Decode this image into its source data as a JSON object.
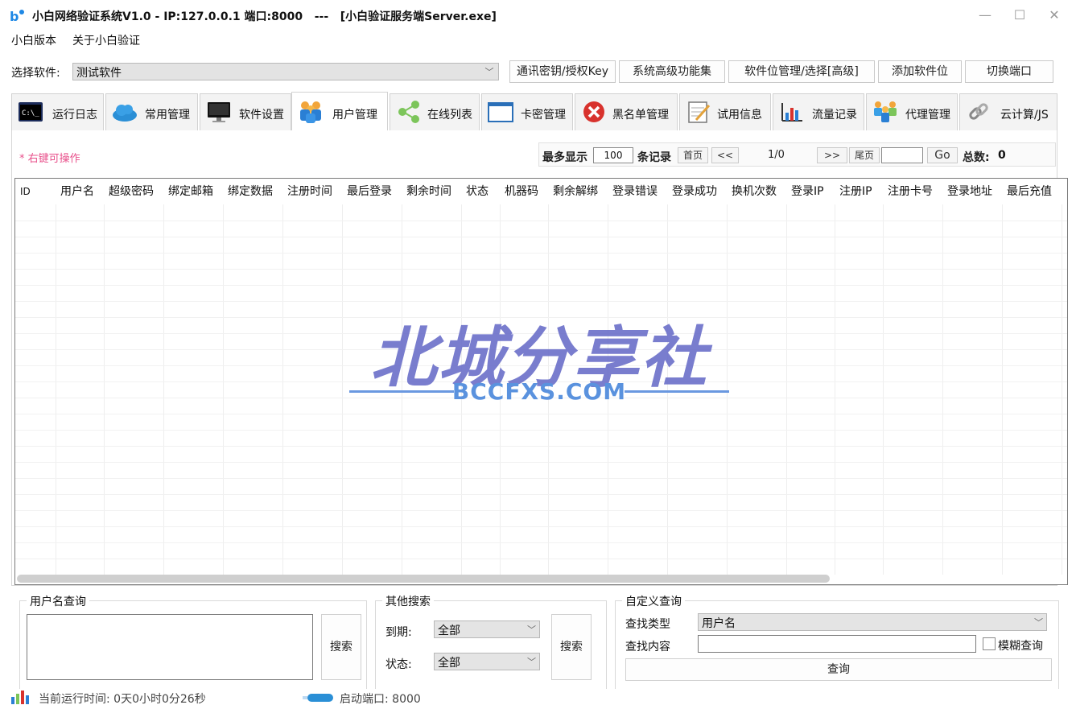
{
  "window": {
    "title": "小白网络验证系统V1.0 - IP:127.0.0.1 端口:8000   ---   [小白验证服务端Server.exe]",
    "minimize": "—",
    "maximize": "☐",
    "close": "✕"
  },
  "menu": [
    "小白版本",
    "关于小白验证"
  ],
  "software_select": {
    "label": "选择软件:",
    "value": "测试软件"
  },
  "top_buttons": [
    "通讯密钥/授权Key",
    "系统高级功能集",
    "软件位管理/选择[高级]",
    "添加软件位",
    "切换端口"
  ],
  "tabs": [
    {
      "label": "运行日志",
      "icon": "console-icon"
    },
    {
      "label": "常用管理",
      "icon": "cloud-icon"
    },
    {
      "label": "软件设置",
      "icon": "monitor-icon"
    },
    {
      "label": "用户管理",
      "icon": "users-icon"
    },
    {
      "label": "在线列表",
      "icon": "share-icon"
    },
    {
      "label": "卡密管理",
      "icon": "window-icon"
    },
    {
      "label": "黑名单管理",
      "icon": "block-icon"
    },
    {
      "label": "试用信息",
      "icon": "notepad-icon"
    },
    {
      "label": "流量记录",
      "icon": "bar-chart-icon"
    },
    {
      "label": "代理管理",
      "icon": "agents-icon"
    },
    {
      "label": "云计算/JS",
      "icon": "chain-link-icon"
    }
  ],
  "hint": "* 右键可操作",
  "pager": {
    "max_label": "最多显示",
    "max_value": "100",
    "records_label": "条记录",
    "first": "首页",
    "prev": "<<",
    "page": "1/0",
    "next": ">>",
    "last": "尾页",
    "goto_value": "",
    "go": "Go",
    "total_label": "总数:",
    "total_value": "0"
  },
  "columns": [
    "ID",
    "用户名",
    "超级密码",
    "绑定邮箱",
    "绑定数据",
    "注册时间",
    "最后登录",
    "剩余时间",
    "状态",
    "机器码",
    "剩余解绑",
    "登录错误",
    "登录成功",
    "换机次数",
    "登录IP",
    "注册IP",
    "注册卡号",
    "登录地址",
    "最后充值"
  ],
  "watermark": {
    "title": "北城分享社",
    "subtitle": "BCCFXS.COM"
  },
  "user_query": {
    "title": "用户名查询",
    "search": "搜索"
  },
  "other_search": {
    "title": "其他搜索",
    "expire_label": "到期:",
    "expire_value": "全部",
    "status_label": "状态:",
    "status_value": "全部",
    "search": "搜索"
  },
  "custom_query": {
    "title": "自定义查询",
    "type_label": "查找类型",
    "type_value": "用户名",
    "content_label": "查找内容",
    "content_value": "",
    "fuzzy_label": "模糊查询",
    "fuzzy_checked": false,
    "query": "查询"
  },
  "status": {
    "runtime": "当前运行时间: 0天0小时0分26秒",
    "port": "启动端口: 8000"
  },
  "colors": {
    "accent": "#1e88e5",
    "hint": "#e8508b",
    "watermark": "#6b6fc9"
  }
}
